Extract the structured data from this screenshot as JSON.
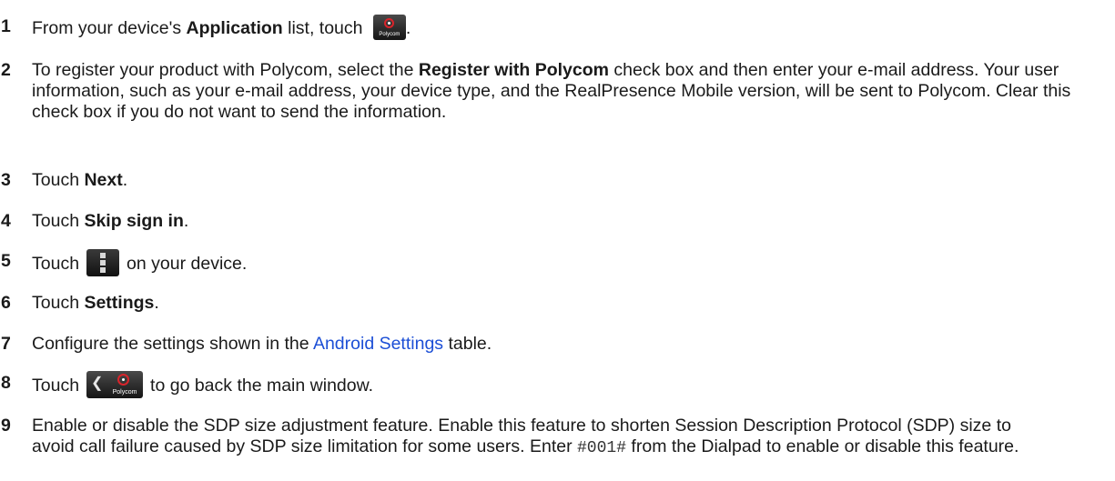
{
  "steps": [
    {
      "number": "1",
      "pre": "From your device's ",
      "bold": "Application",
      "mid": " list, touch ",
      "icon": "polycom-app-icon",
      "icon_text": "Polycom",
      "post": "."
    },
    {
      "number": "2",
      "pre": "To register your product with Polycom, select the ",
      "bold": "Register with Polycom",
      "post": " check box and then enter your e-mail address. Your user information, such as your e-mail address, your device type, and the RealPresence Mobile version, will be sent to Polycom. Clear this check box if you do not want to send the information."
    },
    {
      "number": "3",
      "pre": "Touch ",
      "bold": "Next",
      "post": "."
    },
    {
      "number": "4",
      "pre": "Touch ",
      "bold": "Skip sign in",
      "post": "."
    },
    {
      "number": "5",
      "pre": "Touch",
      "icon": "menu-icon",
      "post": "on your device."
    },
    {
      "number": "6",
      "pre": "Touch ",
      "bold": "Settings",
      "post": "."
    },
    {
      "number": "7",
      "pre": "Configure the settings shown in the ",
      "link": "Android Settings",
      "post": " table."
    },
    {
      "number": "8",
      "pre": "Touch",
      "icon": "back-polycom-icon",
      "icon_text": "Polycom",
      "post": "to go back the main window."
    },
    {
      "number": "9",
      "pre": "Enable or disable the SDP size adjustment feature. Enable this feature to  shorten Session Description Protocol (SDP) size to avoid call failure caused by SDP size limitation for some users. Enter ",
      "code": "#001#",
      "post": " from the Dialpad to enable or disable this feature."
    }
  ],
  "colors": {
    "link": "#1c4fd6",
    "text": "#1a1a1a",
    "logo_red": "#d9242b"
  }
}
